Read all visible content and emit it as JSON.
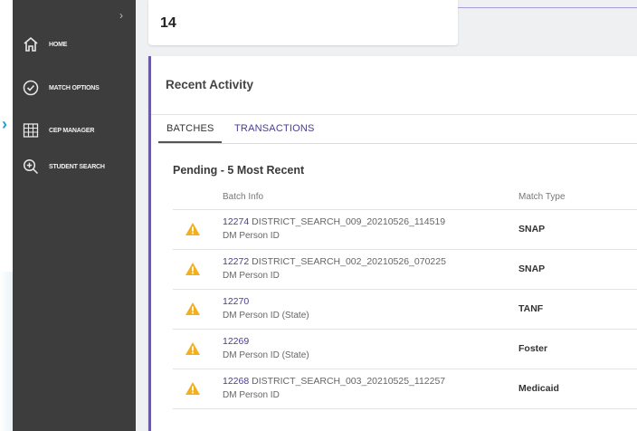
{
  "sidebar": {
    "items": [
      {
        "label": "HOME",
        "icon": "home-icon"
      },
      {
        "label": "MATCH OPTIONS",
        "icon": "check-circle-icon"
      },
      {
        "label": "CEP MANAGER",
        "icon": "grid-icon"
      },
      {
        "label": "STUDENT SEARCH",
        "icon": "zoom-in-icon"
      }
    ]
  },
  "stat": {
    "value": "14"
  },
  "activity": {
    "title": "Recent Activity",
    "tabs": [
      {
        "label": "BATCHES",
        "active": true
      },
      {
        "label": "TRANSACTIONS",
        "active": false
      }
    ],
    "section_title": "Pending - 5 Most Recent",
    "columns": {
      "batch_info": "Batch Info",
      "match_type": "Match Type"
    },
    "rows": [
      {
        "id": "12274",
        "name": " DISTRICT_SEARCH_009_20210526_114519",
        "sub": "DM Person ID",
        "match": "SNAP"
      },
      {
        "id": "12272",
        "name": " DISTRICT_SEARCH_002_20210526_070225",
        "sub": "DM Person ID",
        "match": "SNAP"
      },
      {
        "id": "12270",
        "name": "",
        "sub": "DM Person ID (State)",
        "match": "TANF"
      },
      {
        "id": "12269",
        "name": "",
        "sub": "DM Person ID (State)",
        "match": "Foster"
      },
      {
        "id": "12268",
        "name": " DISTRICT_SEARCH_003_20210525_112257",
        "sub": "DM Person ID",
        "match": "Medicaid"
      }
    ]
  },
  "colors": {
    "sidebar_bg": "#3d3d3d",
    "accent_purple": "#6a5aa8",
    "link": "#4a3d8f",
    "warning": "#f2b01e"
  }
}
